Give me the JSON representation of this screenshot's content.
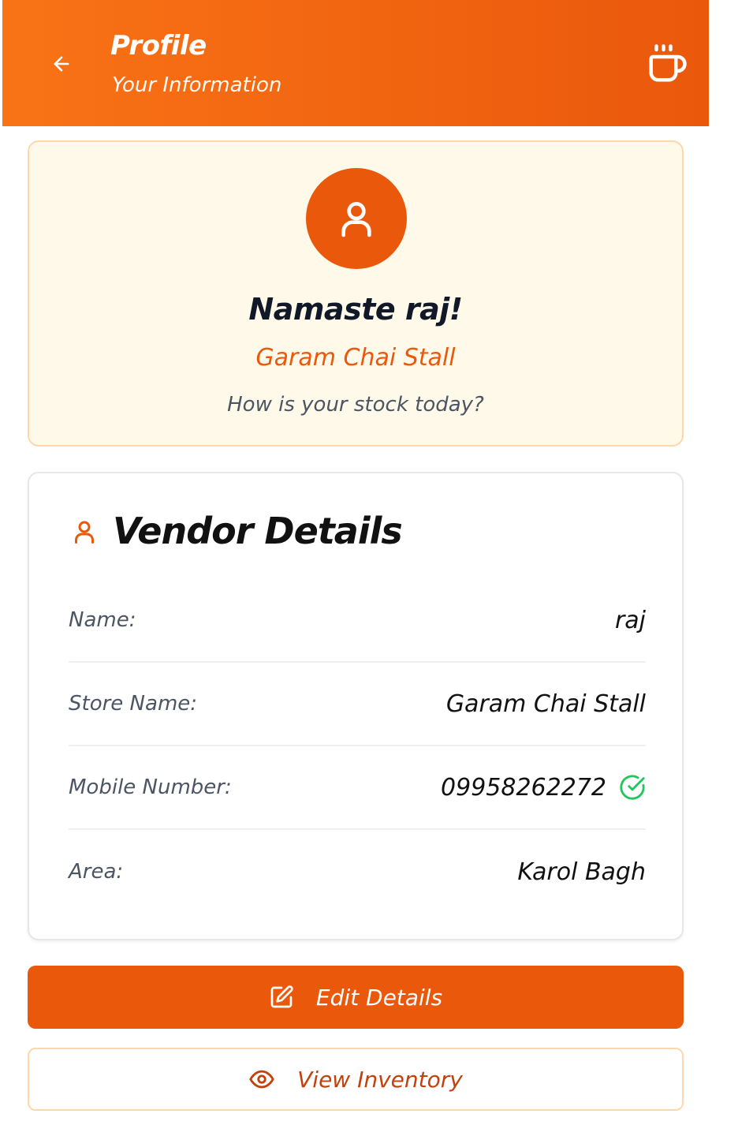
{
  "header": {
    "title": "Profile",
    "subtitle": "Your Information",
    "back_icon": "arrow-left-icon",
    "app_icon": "coffee-cup-icon",
    "gradient_start": "#f97316",
    "gradient_end": "#ea580c"
  },
  "greeting": {
    "avatar_icon": "user-icon",
    "title": "Namaste raj!",
    "store_name": "Garam Chai Stall",
    "question": "How is your stock today?"
  },
  "vendor_details": {
    "title": "Vendor Details",
    "icon": "user-icon",
    "rows": [
      {
        "label": "Name:",
        "value": "raj"
      },
      {
        "label": "Store Name:",
        "value": "Garam Chai Stall"
      },
      {
        "label": "Mobile Number:",
        "value": "09958262272",
        "verified_icon": "check-circle-icon"
      },
      {
        "label": "Area:",
        "value": "Karol Bagh"
      }
    ]
  },
  "actions": {
    "edit_label": "Edit Details",
    "edit_icon": "edit-icon",
    "view_label": "View Inventory",
    "view_icon": "eye-icon"
  },
  "colors": {
    "accent": "#ea580c",
    "verified": "#22c55e",
    "card_bg": "#fff9ea"
  }
}
